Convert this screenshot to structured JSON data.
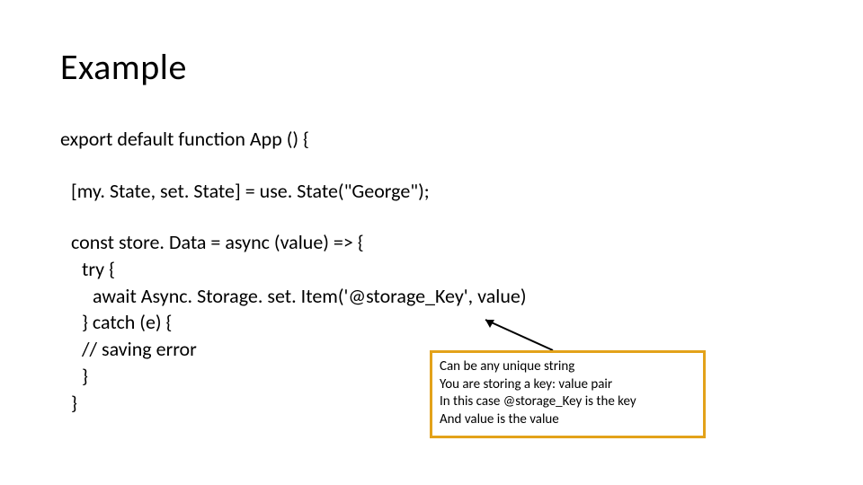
{
  "title": "Example",
  "code": {
    "l1": "export default function App () {",
    "l2": "[my. State, set. State] = use. State(\"George\");",
    "l3": "const store. Data = async (value) => {",
    "l4": "try {",
    "l5": "await Async. Storage. set. Item('@storage_Key', value)",
    "l6": "} catch (e) {",
    "l7": "// saving error",
    "l8": "}",
    "l9": "}"
  },
  "callout": {
    "l1": "Can be any unique string",
    "l2": "You are storing a key: value pair",
    "l3": "In this case @storage_Key is the key",
    "l4": "And value is the value"
  }
}
